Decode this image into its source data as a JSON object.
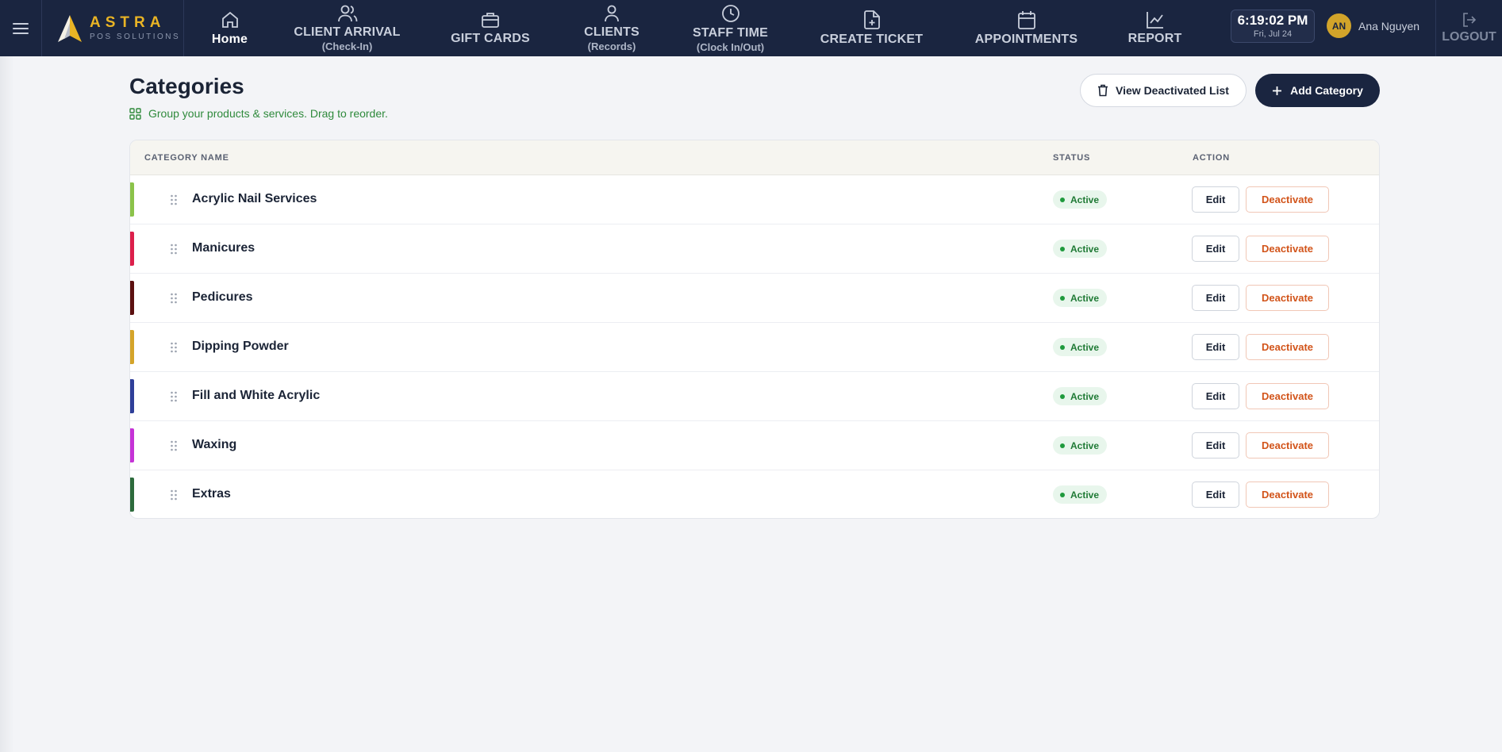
{
  "brand": {
    "name": "ASTRA",
    "subtitle": "POS SOLUTIONS"
  },
  "nav": {
    "home": {
      "label": "Home"
    },
    "client_arrival": {
      "label": "CLIENT ARRIVAL",
      "sub": "(Check-In)"
    },
    "gift_cards": {
      "label": "GIFT CARDS"
    },
    "clients": {
      "label": "CLIENTS",
      "sub": "(Records)"
    },
    "staff_time": {
      "label": "STAFF TIME",
      "sub": "(Clock In/Out)"
    },
    "create_ticket": {
      "label": "CREATE TICKET"
    },
    "appointments": {
      "label": "APPOINTMENTS"
    },
    "report": {
      "label": "REPORT"
    }
  },
  "clock": {
    "time": "6:19:02 PM",
    "date": "Fri, Jul 24"
  },
  "user": {
    "initials": "AN",
    "name": "Ana Nguyen"
  },
  "logout": {
    "label": "LOGOUT"
  },
  "page": {
    "title": "Categories",
    "subtitle": "Group your products & services. Drag to reorder.",
    "view_deactivated_label": "View Deactivated List",
    "add_category_label": "Add Category"
  },
  "table": {
    "headers": {
      "name": "CATEGORY NAME",
      "status": "STATUS",
      "action": "ACTION"
    },
    "edit_label": "Edit",
    "deactivate_label": "Deactivate",
    "rows": [
      {
        "name": "Acrylic Nail Services",
        "status": "Active",
        "color": "#8bc34a"
      },
      {
        "name": "Manicures",
        "status": "Active",
        "color": "#dc1f4b"
      },
      {
        "name": "Pedicures",
        "status": "Active",
        "color": "#5c1010"
      },
      {
        "name": "Dipping Powder",
        "status": "Active",
        "color": "#d4a42a"
      },
      {
        "name": "Fill and White Acrylic",
        "status": "Active",
        "color": "#2f3f99"
      },
      {
        "name": "Waxing",
        "status": "Active",
        "color": "#c533d6"
      },
      {
        "name": "Extras",
        "status": "Active",
        "color": "#2d6b3c"
      }
    ]
  },
  "colors": {
    "navbar": "#1a2540",
    "accent": "#e9b425",
    "active": "#1f7a35",
    "deactivate": "#d2541a"
  }
}
